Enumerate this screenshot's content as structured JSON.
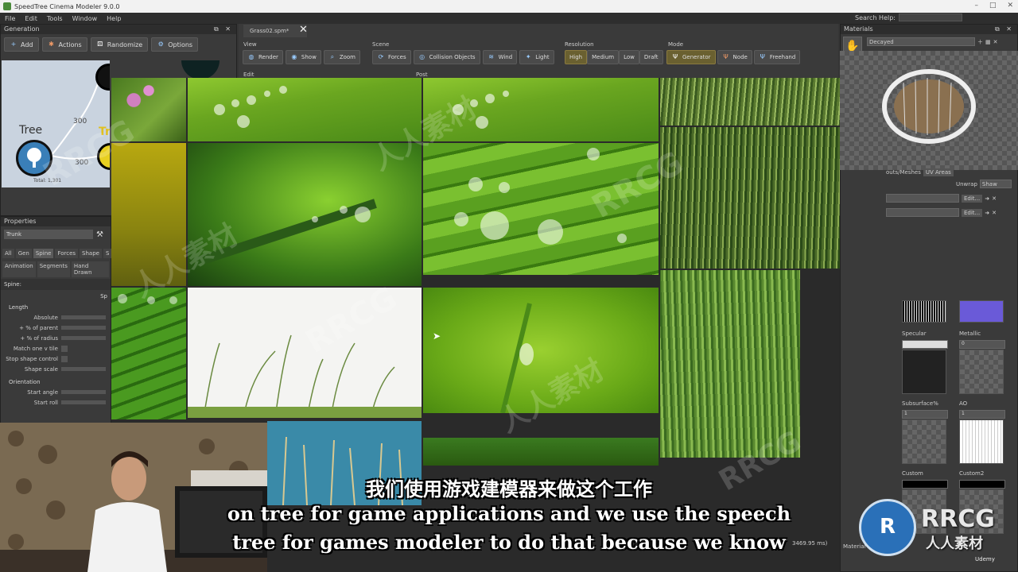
{
  "window": {
    "title": "SpeedTree Cinema Modeler 9.0.0",
    "controls": [
      "–",
      "□",
      "✕"
    ]
  },
  "menu": [
    "File",
    "Edit",
    "Tools",
    "Window",
    "Help"
  ],
  "search_help": {
    "label": "Search Help:",
    "value": ""
  },
  "generation": {
    "title": "Generation",
    "toolbar": [
      {
        "label": "Add",
        "icon": "plus-icon"
      },
      {
        "label": "Actions",
        "icon": "actions-icon"
      },
      {
        "label": "Randomize",
        "icon": "dice-icon"
      },
      {
        "label": "Options",
        "icon": "gear-icon"
      }
    ],
    "graph": {
      "node_tree_label": "Tree",
      "node_tree_label_2": "Tr",
      "edge_labels": [
        "300",
        "300"
      ],
      "total": "Total: 1,301"
    }
  },
  "properties": {
    "title": "Properties",
    "object_value": "Trunk",
    "tabs_row1": [
      "All",
      "Gen",
      "Spine",
      "Forces",
      "Shape",
      "S"
    ],
    "tabs_row2": [
      "Animation",
      "Segments",
      "Hand Drawn"
    ],
    "section_path": "Spine:",
    "section_right": "Sp",
    "length_header": "Length",
    "length_rows": [
      "Absolute",
      "+ % of parent",
      "+ % of radius",
      "Match one v tile",
      "Stop shape control",
      "Shape scale"
    ],
    "orientation_header": "Orientation",
    "orientation_rows": [
      "Start angle",
      "Start roll"
    ]
  },
  "document": {
    "tab": "Grass02.spm*"
  },
  "toolbar": {
    "view_label": "View",
    "view": [
      "Render",
      "Show",
      "Zoom"
    ],
    "scene_label": "Scene",
    "scene": [
      "Forces",
      "Collision Objects",
      "Wind",
      "Light"
    ],
    "resolution_label": "Resolution",
    "resolution": [
      "High",
      "Medium",
      "Low",
      "Draft"
    ],
    "mode_label": "Mode",
    "mode": [
      "Generator",
      "Node",
      "Freehand"
    ],
    "edit_label": "Edit",
    "post_label": "Post"
  },
  "materials": {
    "title": "Materials",
    "selected": "Decayed",
    "tabs": [
      "outs/Meshes",
      "UV Areas"
    ],
    "unwrap_label": "Unwrap",
    "unwrap_value": "Shaw",
    "edit_buttons": [
      "Edit...",
      "Edit..."
    ],
    "maps": [
      {
        "label": "Specular",
        "value": ""
      },
      {
        "label": "Metallic",
        "value": "0"
      },
      {
        "label": "Subsurface%",
        "value": "1"
      },
      {
        "label": "AO",
        "value": "1"
      },
      {
        "label": "Custom",
        "value": ""
      },
      {
        "label": "Custom2",
        "value": ""
      }
    ]
  },
  "status": {
    "timing": "3469.95 ms)",
    "bottom_right_a": "Material",
    "bottom_right_b": "Udemy"
  },
  "subtitles": {
    "cn": "我们使用游戏建模器来做这个工作",
    "en1": "on tree for game applications and we use the speech",
    "en2": "tree for games modeler to do that because we know"
  },
  "watermark": {
    "brand": "RRCG",
    "cn": "人人素材",
    "logo_text": "RRCG",
    "logo_sub": "人人素材"
  },
  "colors": {
    "accent_yellow": "#e0c020",
    "grass_green": "#6aa62a",
    "panel_bg": "#3a3a3a"
  }
}
